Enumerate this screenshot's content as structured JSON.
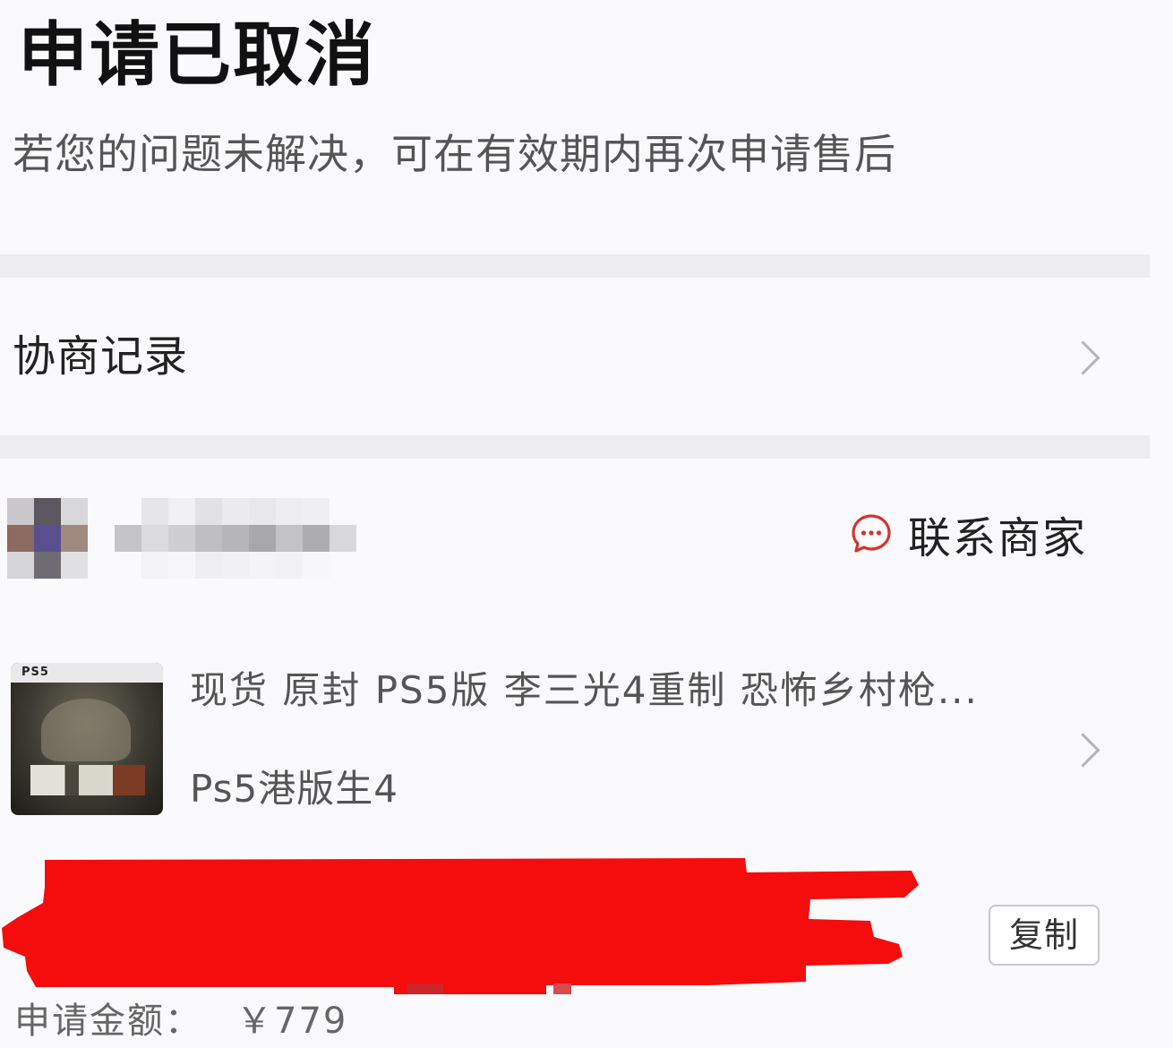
{
  "status": {
    "title": "申请已取消",
    "subtitle": "若您的问题未解决，可在有效期内再次申请售后"
  },
  "negotiation": {
    "label": "协商记录"
  },
  "store": {
    "contact_label": "联系商家"
  },
  "product": {
    "title": "现货 原封 PS5版 李三光4重制 恐怖乡村枪...",
    "spec": "Ps5港版生4",
    "thumb_brand": "PS5"
  },
  "order": {
    "copy_label": "复制"
  },
  "refund": {
    "amount_label": "申请金额：",
    "amount_value": "￥779"
  },
  "colors": {
    "redaction": "#f50c0c",
    "chat_icon": "#d6322f",
    "chevron": "#b5b5b8",
    "section_gap": "#ededf0"
  },
  "icons": {
    "chat": "chat-bubble-icon",
    "chevron": "chevron-right-icon"
  }
}
